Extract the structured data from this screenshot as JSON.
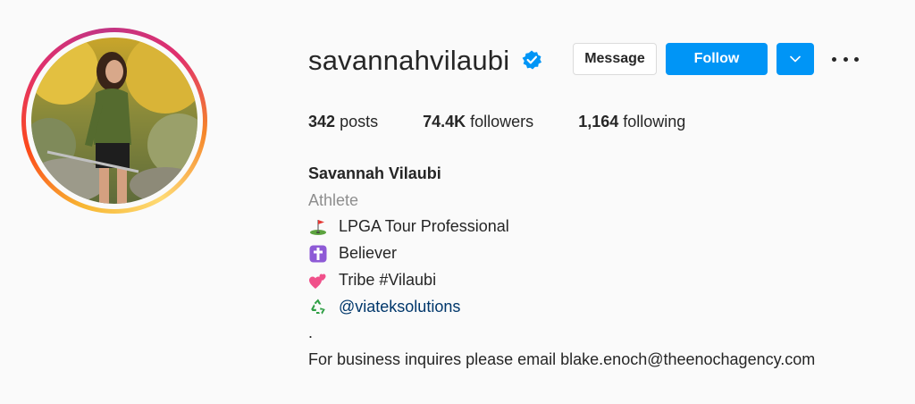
{
  "profile": {
    "username": "savannahvilaubi",
    "verified": true
  },
  "actions": {
    "message_label": "Message",
    "follow_label": "Follow"
  },
  "stats": [
    {
      "value": "342",
      "label": "posts"
    },
    {
      "value": "74.4K",
      "label": "followers"
    },
    {
      "value": "1,164",
      "label": "following"
    }
  ],
  "bio": {
    "full_name": "Savannah Vilaubi",
    "category": "Athlete",
    "lines": [
      {
        "icon": "golf-flag-icon",
        "text": "LPGA Tour Professional"
      },
      {
        "icon": "cross-icon",
        "text": "Believer"
      },
      {
        "icon": "two-hearts-icon",
        "text": "Tribe #Vilaubi"
      },
      {
        "icon": "recycle-icon",
        "text": "@viateksolutions"
      }
    ],
    "dot": ".",
    "business": "For business inquires please email blake.enoch@theenochagency.com"
  },
  "colors": {
    "accent": "#0095f6",
    "link": "#00376b",
    "muted": "#8e8e8e"
  }
}
